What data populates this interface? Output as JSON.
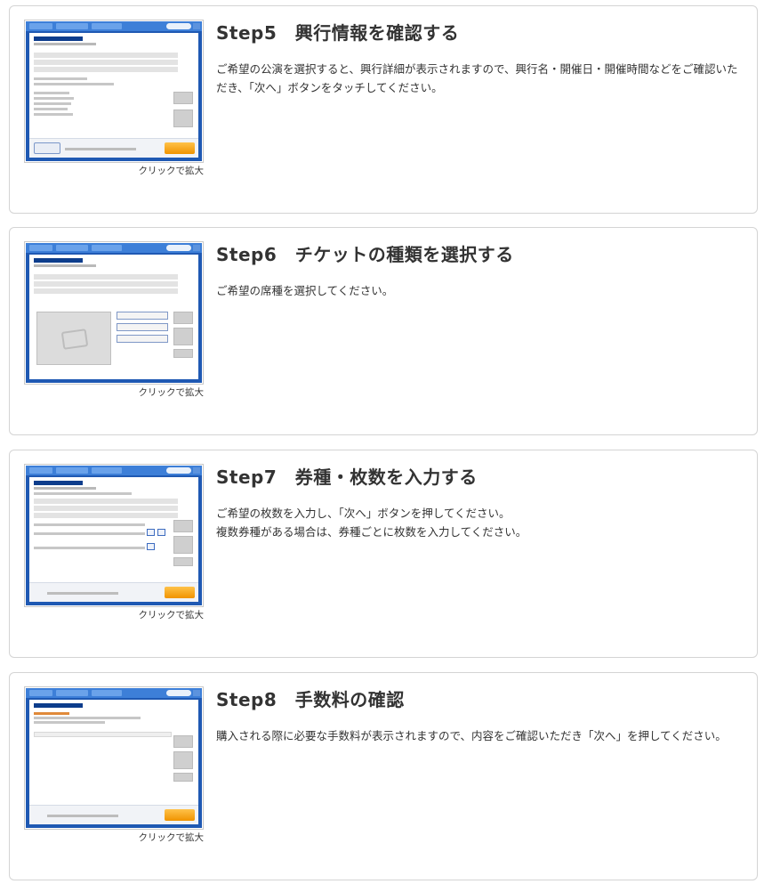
{
  "zoom_caption": "クリックで拡大",
  "steps": [
    {
      "title": "Step5　興行情報を確認する",
      "desc": [
        "ご希望の公演を選択すると、興行詳細が表示されますので、興行名・開催日・開催時間などをご確認いただき、「次へ」ボタンをタッチしてください。"
      ]
    },
    {
      "title": "Step6　チケットの種類を選択する",
      "desc": [
        "ご希望の席種を選択してください。"
      ]
    },
    {
      "title": "Step7　券種・枚数を入力する",
      "desc": [
        "ご希望の枚数を入力し、「次へ」ボタンを押してください。",
        "複数券種がある場合は、券種ごとに枚数を入力してください。"
      ]
    },
    {
      "title": "Step8　手数料の確認",
      "desc": [
        "購入される際に必要な手数料が表示されますので、内容をご確認いただき「次へ」を押してください。"
      ]
    }
  ],
  "colors": {
    "kiosk_frame": "#1f59b3",
    "kiosk_title": "#0d3d8c",
    "next_button": "#f09300",
    "card_border": "#d4d4d4",
    "text": "#333333"
  }
}
